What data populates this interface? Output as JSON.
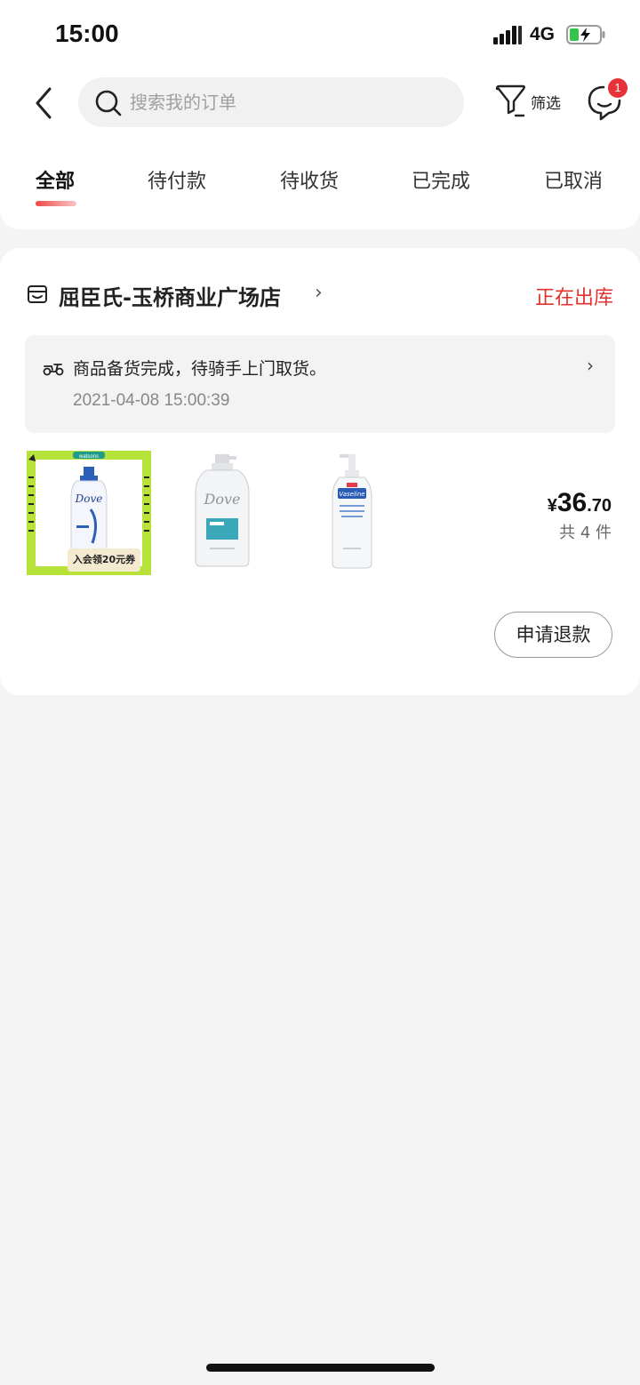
{
  "status_bar": {
    "time": "15:00",
    "network": "4G",
    "battery_icon": "battery-charging-icon"
  },
  "header": {
    "search_placeholder": "搜索我的订单",
    "filter_label": "筛选",
    "message_badge": "1"
  },
  "tabs": [
    {
      "label": "全部",
      "active": true
    },
    {
      "label": "待付款",
      "active": false
    },
    {
      "label": "待收货",
      "active": false
    },
    {
      "label": "已完成",
      "active": false
    },
    {
      "label": "已取消",
      "active": false
    }
  ],
  "order": {
    "store_name": "屈臣氏-玉桥商业广场店",
    "status": "正在出库",
    "status_color": "#e3322d",
    "notice": {
      "text": "商品备货完成，待骑手上门取货。",
      "time": "2021-04-08 15:00:39"
    },
    "products": [
      {
        "name": "Dove",
        "kind": "shampoo-promo",
        "promo_brand": "watsons",
        "promo_text": "入会领20元券"
      },
      {
        "name": "Dove",
        "kind": "shampoo"
      },
      {
        "name": "Vaseline",
        "kind": "lotion"
      }
    ],
    "price": {
      "currency": "¥",
      "integer": "36",
      "decimal": ".70"
    },
    "count": "共 4 件",
    "refund_label": "申请退款"
  },
  "colors": {
    "accent": "#e3322d",
    "background": "#f4f4f4",
    "promo_green": "#b7e23a"
  }
}
